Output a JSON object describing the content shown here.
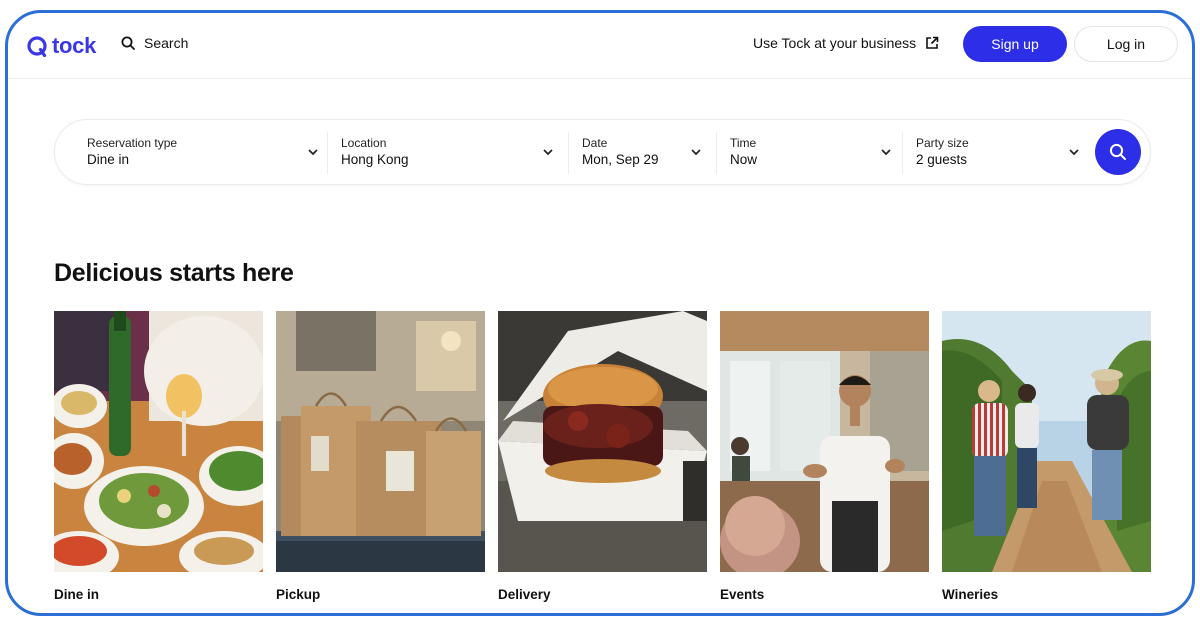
{
  "header": {
    "logo_text": "tock",
    "search_label": "Search",
    "business_link": "Use Tock at your business",
    "signup_label": "Sign up",
    "login_label": "Log in"
  },
  "searchbar": {
    "fields": [
      {
        "label": "Reservation type",
        "value": "Dine in"
      },
      {
        "label": "Location",
        "value": "Hong Kong"
      },
      {
        "label": "Date",
        "value": "Mon, Sep 29"
      },
      {
        "label": "Time",
        "value": "Now"
      },
      {
        "label": "Party size",
        "value": "2 guests"
      }
    ]
  },
  "section": {
    "heading": "Delicious starts here",
    "categories": [
      {
        "label": "Dine in",
        "image": "dine-in-photo"
      },
      {
        "label": "Pickup",
        "image": "pickup-photo"
      },
      {
        "label": "Delivery",
        "image": "delivery-photo"
      },
      {
        "label": "Events",
        "image": "events-photo"
      },
      {
        "label": "Wineries",
        "image": "wineries-photo"
      }
    ]
  },
  "colors": {
    "brand": "#2d2ee8",
    "frame_border": "#2b6fd6",
    "logo": "#3b37e6"
  }
}
